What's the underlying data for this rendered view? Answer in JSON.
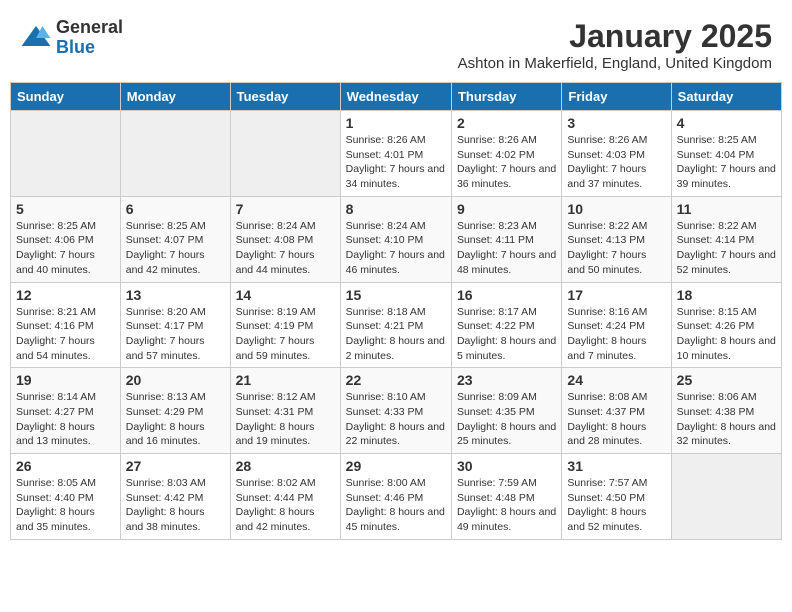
{
  "header": {
    "logo_general": "General",
    "logo_blue": "Blue",
    "month_title": "January 2025",
    "location": "Ashton in Makerfield, England, United Kingdom"
  },
  "weekdays": [
    "Sunday",
    "Monday",
    "Tuesday",
    "Wednesday",
    "Thursday",
    "Friday",
    "Saturday"
  ],
  "weeks": [
    [
      {
        "day": "",
        "sunrise": "",
        "sunset": "",
        "daylight": ""
      },
      {
        "day": "",
        "sunrise": "",
        "sunset": "",
        "daylight": ""
      },
      {
        "day": "",
        "sunrise": "",
        "sunset": "",
        "daylight": ""
      },
      {
        "day": "1",
        "sunrise": "Sunrise: 8:26 AM",
        "sunset": "Sunset: 4:01 PM",
        "daylight": "Daylight: 7 hours and 34 minutes."
      },
      {
        "day": "2",
        "sunrise": "Sunrise: 8:26 AM",
        "sunset": "Sunset: 4:02 PM",
        "daylight": "Daylight: 7 hours and 36 minutes."
      },
      {
        "day": "3",
        "sunrise": "Sunrise: 8:26 AM",
        "sunset": "Sunset: 4:03 PM",
        "daylight": "Daylight: 7 hours and 37 minutes."
      },
      {
        "day": "4",
        "sunrise": "Sunrise: 8:25 AM",
        "sunset": "Sunset: 4:04 PM",
        "daylight": "Daylight: 7 hours and 39 minutes."
      }
    ],
    [
      {
        "day": "5",
        "sunrise": "Sunrise: 8:25 AM",
        "sunset": "Sunset: 4:06 PM",
        "daylight": "Daylight: 7 hours and 40 minutes."
      },
      {
        "day": "6",
        "sunrise": "Sunrise: 8:25 AM",
        "sunset": "Sunset: 4:07 PM",
        "daylight": "Daylight: 7 hours and 42 minutes."
      },
      {
        "day": "7",
        "sunrise": "Sunrise: 8:24 AM",
        "sunset": "Sunset: 4:08 PM",
        "daylight": "Daylight: 7 hours and 44 minutes."
      },
      {
        "day": "8",
        "sunrise": "Sunrise: 8:24 AM",
        "sunset": "Sunset: 4:10 PM",
        "daylight": "Daylight: 7 hours and 46 minutes."
      },
      {
        "day": "9",
        "sunrise": "Sunrise: 8:23 AM",
        "sunset": "Sunset: 4:11 PM",
        "daylight": "Daylight: 7 hours and 48 minutes."
      },
      {
        "day": "10",
        "sunrise": "Sunrise: 8:22 AM",
        "sunset": "Sunset: 4:13 PM",
        "daylight": "Daylight: 7 hours and 50 minutes."
      },
      {
        "day": "11",
        "sunrise": "Sunrise: 8:22 AM",
        "sunset": "Sunset: 4:14 PM",
        "daylight": "Daylight: 7 hours and 52 minutes."
      }
    ],
    [
      {
        "day": "12",
        "sunrise": "Sunrise: 8:21 AM",
        "sunset": "Sunset: 4:16 PM",
        "daylight": "Daylight: 7 hours and 54 minutes."
      },
      {
        "day": "13",
        "sunrise": "Sunrise: 8:20 AM",
        "sunset": "Sunset: 4:17 PM",
        "daylight": "Daylight: 7 hours and 57 minutes."
      },
      {
        "day": "14",
        "sunrise": "Sunrise: 8:19 AM",
        "sunset": "Sunset: 4:19 PM",
        "daylight": "Daylight: 7 hours and 59 minutes."
      },
      {
        "day": "15",
        "sunrise": "Sunrise: 8:18 AM",
        "sunset": "Sunset: 4:21 PM",
        "daylight": "Daylight: 8 hours and 2 minutes."
      },
      {
        "day": "16",
        "sunrise": "Sunrise: 8:17 AM",
        "sunset": "Sunset: 4:22 PM",
        "daylight": "Daylight: 8 hours and 5 minutes."
      },
      {
        "day": "17",
        "sunrise": "Sunrise: 8:16 AM",
        "sunset": "Sunset: 4:24 PM",
        "daylight": "Daylight: 8 hours and 7 minutes."
      },
      {
        "day": "18",
        "sunrise": "Sunrise: 8:15 AM",
        "sunset": "Sunset: 4:26 PM",
        "daylight": "Daylight: 8 hours and 10 minutes."
      }
    ],
    [
      {
        "day": "19",
        "sunrise": "Sunrise: 8:14 AM",
        "sunset": "Sunset: 4:27 PM",
        "daylight": "Daylight: 8 hours and 13 minutes."
      },
      {
        "day": "20",
        "sunrise": "Sunrise: 8:13 AM",
        "sunset": "Sunset: 4:29 PM",
        "daylight": "Daylight: 8 hours and 16 minutes."
      },
      {
        "day": "21",
        "sunrise": "Sunrise: 8:12 AM",
        "sunset": "Sunset: 4:31 PM",
        "daylight": "Daylight: 8 hours and 19 minutes."
      },
      {
        "day": "22",
        "sunrise": "Sunrise: 8:10 AM",
        "sunset": "Sunset: 4:33 PM",
        "daylight": "Daylight: 8 hours and 22 minutes."
      },
      {
        "day": "23",
        "sunrise": "Sunrise: 8:09 AM",
        "sunset": "Sunset: 4:35 PM",
        "daylight": "Daylight: 8 hours and 25 minutes."
      },
      {
        "day": "24",
        "sunrise": "Sunrise: 8:08 AM",
        "sunset": "Sunset: 4:37 PM",
        "daylight": "Daylight: 8 hours and 28 minutes."
      },
      {
        "day": "25",
        "sunrise": "Sunrise: 8:06 AM",
        "sunset": "Sunset: 4:38 PM",
        "daylight": "Daylight: 8 hours and 32 minutes."
      }
    ],
    [
      {
        "day": "26",
        "sunrise": "Sunrise: 8:05 AM",
        "sunset": "Sunset: 4:40 PM",
        "daylight": "Daylight: 8 hours and 35 minutes."
      },
      {
        "day": "27",
        "sunrise": "Sunrise: 8:03 AM",
        "sunset": "Sunset: 4:42 PM",
        "daylight": "Daylight: 8 hours and 38 minutes."
      },
      {
        "day": "28",
        "sunrise": "Sunrise: 8:02 AM",
        "sunset": "Sunset: 4:44 PM",
        "daylight": "Daylight: 8 hours and 42 minutes."
      },
      {
        "day": "29",
        "sunrise": "Sunrise: 8:00 AM",
        "sunset": "Sunset: 4:46 PM",
        "daylight": "Daylight: 8 hours and 45 minutes."
      },
      {
        "day": "30",
        "sunrise": "Sunrise: 7:59 AM",
        "sunset": "Sunset: 4:48 PM",
        "daylight": "Daylight: 8 hours and 49 minutes."
      },
      {
        "day": "31",
        "sunrise": "Sunrise: 7:57 AM",
        "sunset": "Sunset: 4:50 PM",
        "daylight": "Daylight: 8 hours and 52 minutes."
      },
      {
        "day": "",
        "sunrise": "",
        "sunset": "",
        "daylight": ""
      }
    ]
  ]
}
